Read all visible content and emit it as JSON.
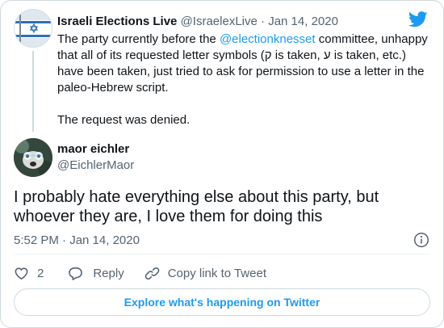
{
  "colors": {
    "accent": "#1d9bf0",
    "text": "#0f1419",
    "muted": "#536471",
    "border": "#cfd9de"
  },
  "parent_tweet": {
    "display_name": "Israeli Elections Live",
    "handle": "@IsraelexLive",
    "separator": "·",
    "date": "Jan 14, 2020",
    "text_before_mention": "The party currently before the ",
    "mention": "@electionknesset",
    "text_after_mention": " committee, unhappy that all of its requested letter symbols (ק is taken, ע is taken, etc.) have been taken, just tried to ask for permission to use a letter in the paleo-Hebrew script.",
    "text_second_paragraph": "The request was denied.",
    "avatar_icon": "israeli-flag-avatar"
  },
  "main_tweet": {
    "display_name": "maor eichler",
    "handle": "@EichlerMaor",
    "text": "I probably hate everything else about this party, but whoever they are, I love them for doing this",
    "timestamp": "5:52 PM · Jan 14, 2020",
    "avatar_icon": "dog-photo-avatar"
  },
  "actions": {
    "like_count": "2",
    "reply_label": "Reply",
    "copy_link_label": "Copy link to Tweet"
  },
  "explore_label": "Explore what's happening on Twitter",
  "icons": {
    "brand": "twitter-bird-icon",
    "info": "info-icon",
    "like": "heart-icon",
    "reply": "reply-bubble-icon",
    "copy": "link-icon"
  }
}
